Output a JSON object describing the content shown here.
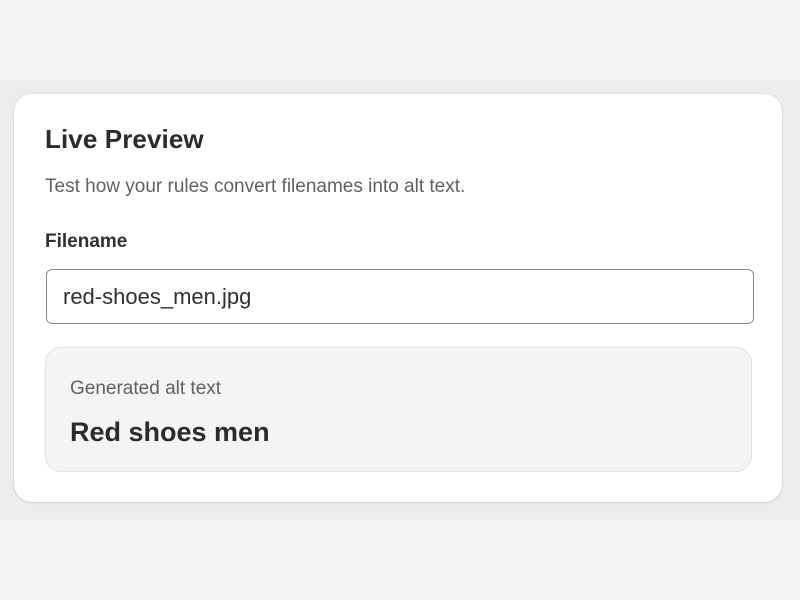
{
  "preview_card": {
    "title": "Live Preview",
    "description": "Test how your rules convert filenames into alt text.",
    "filename_label": "Filename",
    "filename_value": "red-shoes_men.jpg",
    "result_label": "Generated alt text",
    "result_value": "Red shoes men"
  }
}
